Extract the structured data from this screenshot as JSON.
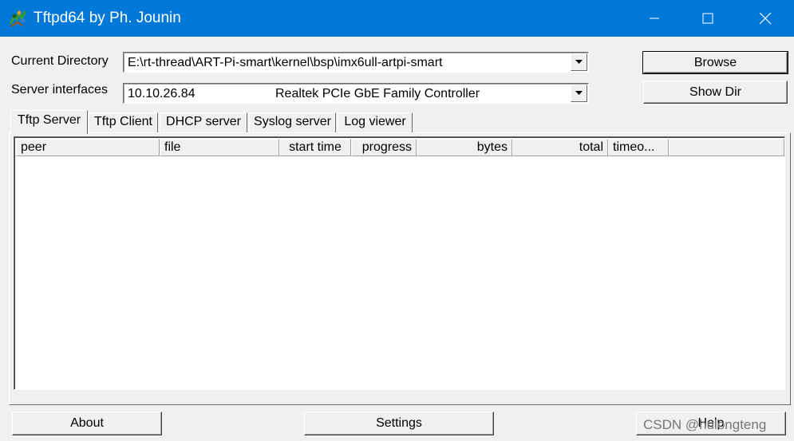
{
  "window": {
    "title": "Tftpd64 by Ph. Jounin",
    "minimize_icon": "minimize-icon",
    "maximize_icon": "maximize-icon",
    "close_icon": "close-icon",
    "app_icon": "tftpd-app-icon"
  },
  "form": {
    "current_directory_label": "Current Directory",
    "current_directory_value": "E:\\rt-thread\\ART-Pi-smart\\kernel\\bsp\\imx6ull-artpi-smart",
    "server_interfaces_label": "Server interfaces",
    "server_interface_ip": "10.10.26.84",
    "server_interface_name": "Realtek PCIe GbE Family Controller",
    "browse_label": "Browse",
    "show_dir_label": "Show Dir"
  },
  "tabs": [
    {
      "label": "Tftp Server",
      "active": true
    },
    {
      "label": "Tftp Client",
      "active": false
    },
    {
      "label": "DHCP server",
      "active": false
    },
    {
      "label": "Syslog server",
      "active": false
    },
    {
      "label": "Log viewer",
      "active": false
    }
  ],
  "table": {
    "columns": [
      "peer",
      "file",
      "start time",
      "progress",
      "bytes",
      "total",
      "timeo..."
    ],
    "rows": []
  },
  "footer": {
    "about_label": "About",
    "settings_label": "Settings",
    "help_label": "Help"
  },
  "watermark": "CSDN @hulongteng",
  "colors": {
    "titlebar": "#0078d7",
    "window_bg": "#f0f0f0"
  }
}
